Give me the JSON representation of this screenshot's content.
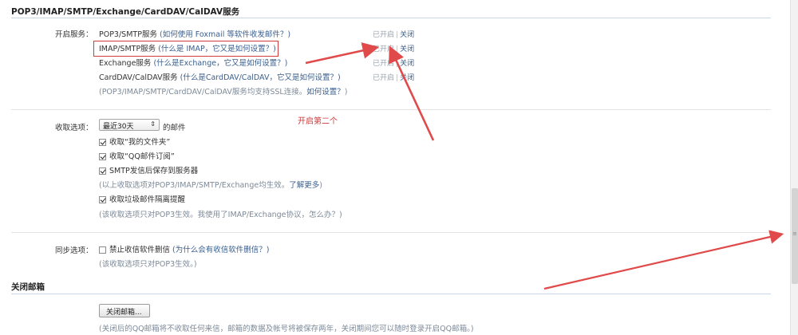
{
  "section1": {
    "title": "POP3/IMAP/SMTP/Exchange/CardDAV/CalDAV服务",
    "label": "开启服务：",
    "services": [
      {
        "name": "POP3/SMTP服务",
        "hint": "(如何使用 Foxmail 等软件收发邮件？)",
        "status": "已开启",
        "sep": "|",
        "action": "关闭"
      },
      {
        "name": "IMAP/SMTP服务",
        "hint": "(什么是 IMAP，它又是如何设置？)",
        "status": "已开启",
        "sep": "|",
        "action": "关闭"
      },
      {
        "name": "Exchange服务",
        "hint": "(什么是Exchange，它又是如何设置？)",
        "status": "已开启",
        "sep": "|",
        "action": "关闭"
      },
      {
        "name": "CardDAV/CalDAV服务",
        "hint": "(什么是CardDAV/CalDAV，它又是如何设置？)",
        "status": "已开启",
        "sep": "|",
        "action": "关闭"
      }
    ],
    "ssl_note": "(POP3/IMAP/SMTP/CardDAV/CalDAV服务均支持SSL连接。",
    "ssl_link": "如何设置？",
    "ssl_close": ")"
  },
  "receive": {
    "label": "收取选项：",
    "select_value": "最近30天",
    "select_arrow": "⇕",
    "select_suffix": "的邮件",
    "options": [
      {
        "text": "收取“我的文件夹”",
        "checked": true
      },
      {
        "text": "收取“QQ邮件订阅”",
        "checked": true
      },
      {
        "text": "SMTP发信后保存到服务器",
        "checked": true
      }
    ],
    "note1": "(以上收取选项对POP3/IMAP/SMTP/Exchange均生效。",
    "note1_link": "了解更多",
    "note1_close": ")",
    "spam_option": "收取垃圾邮件隔离提醒",
    "note2": "(该收取选项只对POP3生效。我使用了IMAP/Exchange协议，怎么办？)"
  },
  "annotation": "开启第二个",
  "sync": {
    "label": "同步选项：",
    "option": "禁止收信软件删信",
    "option_hint": "(为什么会有收信软件删信？)",
    "note": "(该收取选项只对POP3生效。)"
  },
  "close_mailbox": {
    "title": "关闭邮箱",
    "button": "关闭邮箱...",
    "note": "(关闭后的QQ邮箱将不收取任何来信，邮箱的数据及帐号将被保存两年，关闭期间您可以随时登录开启QQ邮箱。)"
  },
  "colors": {
    "annotation": "#cc3b3b",
    "link": "#3a5f8f",
    "hint": "#7d8a99"
  }
}
